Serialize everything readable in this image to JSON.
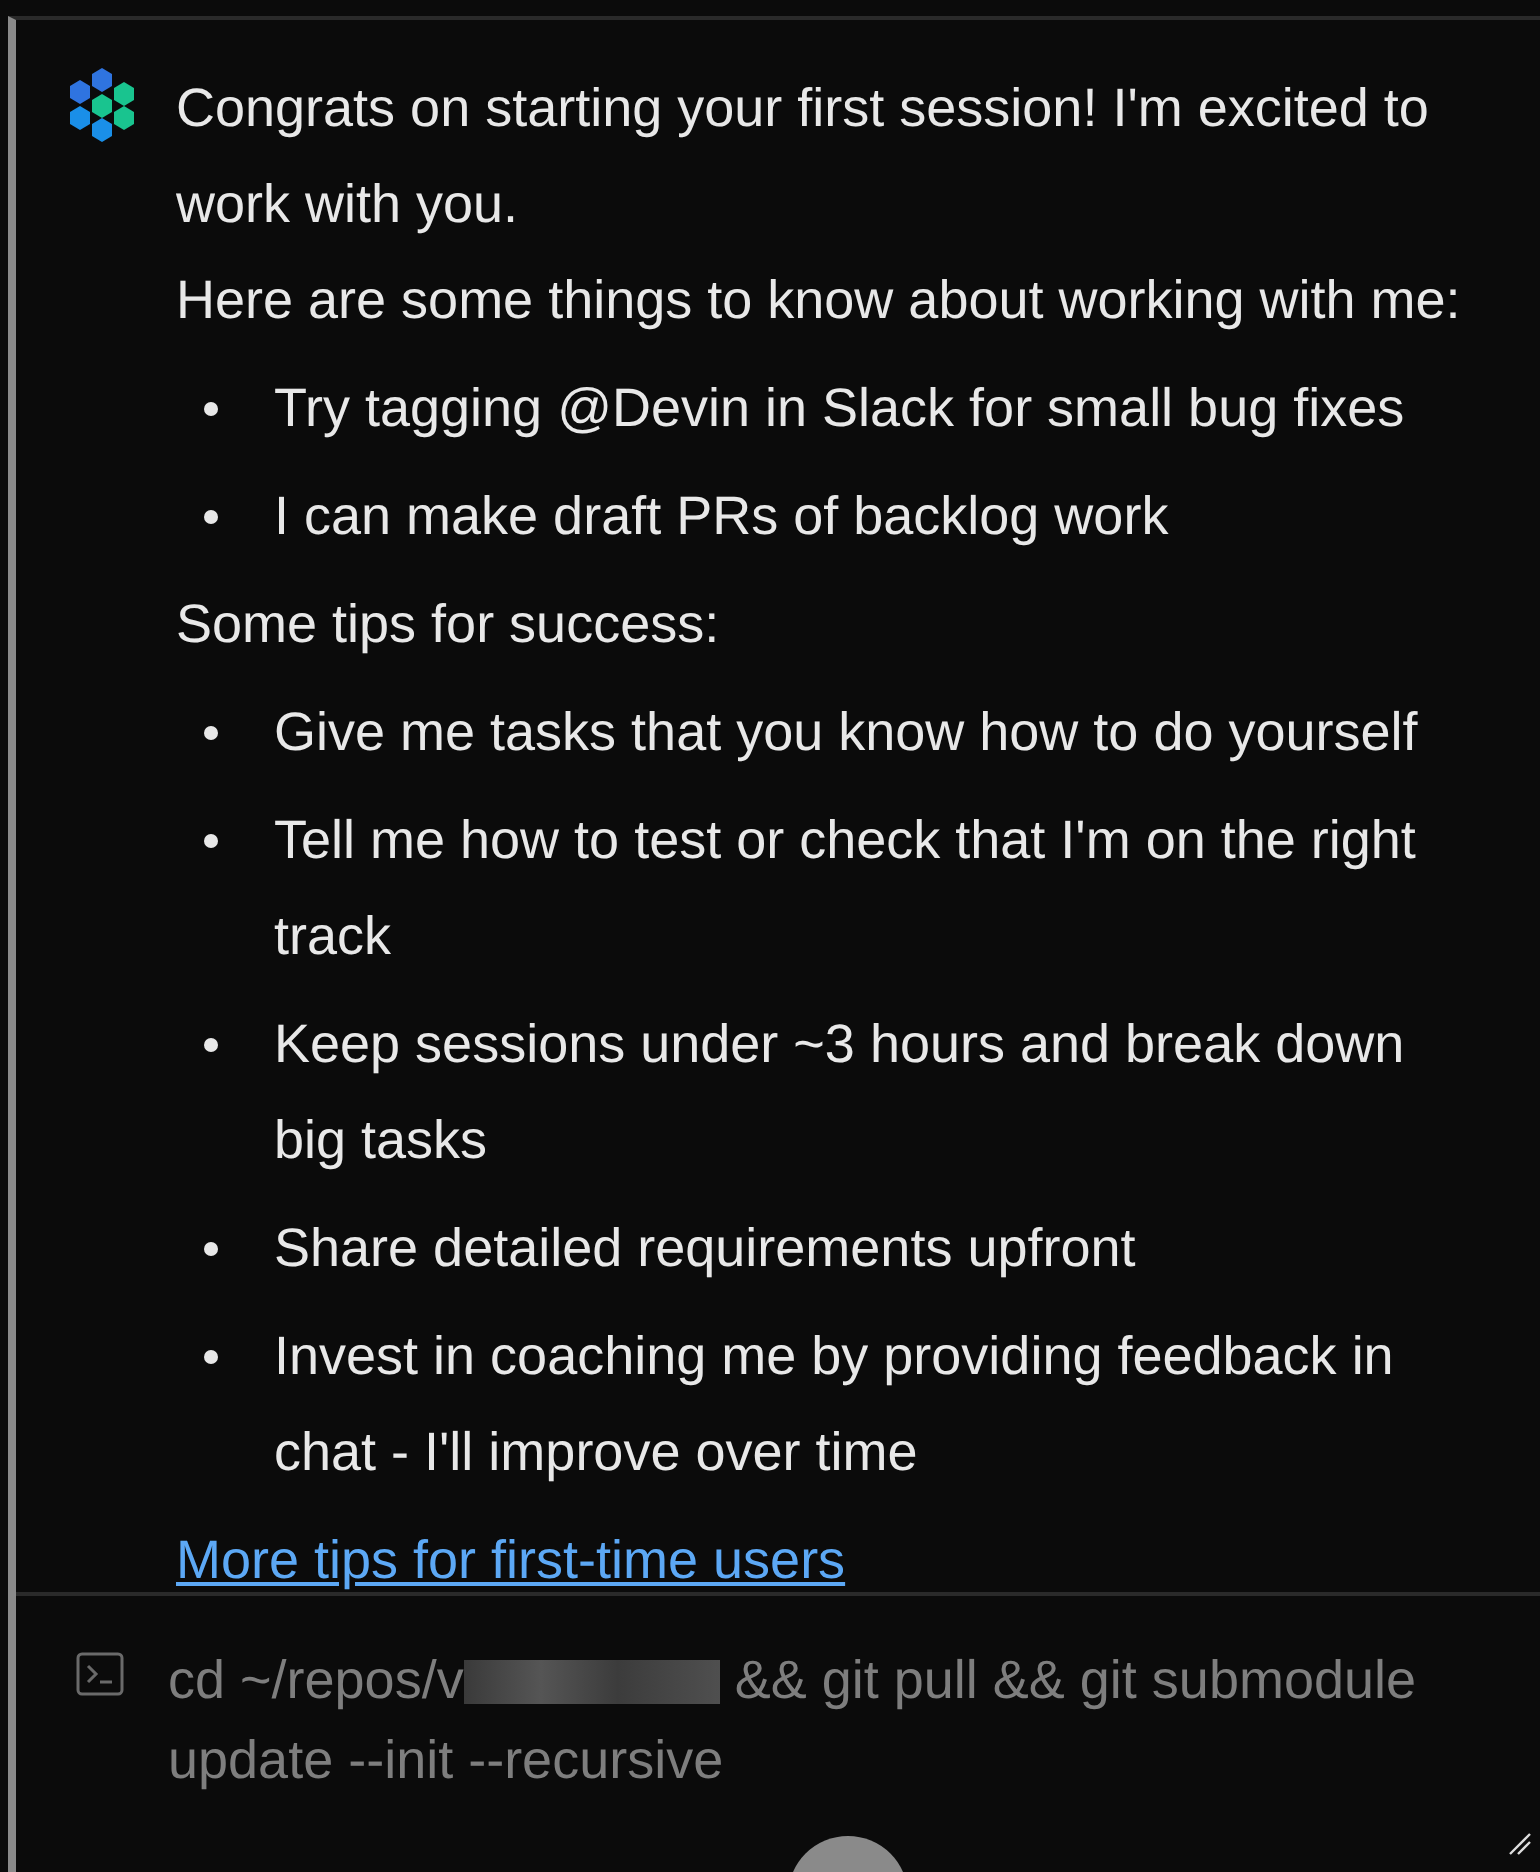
{
  "message": {
    "blocks": [
      {
        "kind": "paragraph",
        "text": "Congrats on starting your first session! I'm excited to work with you."
      },
      {
        "kind": "paragraph",
        "text": "Here are some things to know about working with me:"
      },
      {
        "kind": "list",
        "items": [
          "Try tagging @Devin in Slack for small bug fixes",
          "I can make draft PRs of backlog work"
        ]
      },
      {
        "kind": "paragraph",
        "text": "Some tips for success:"
      },
      {
        "kind": "list",
        "items": [
          "Give me tasks that you know how to do yourself",
          "Tell me how to test or check that I'm on the right track",
          "Keep sessions under ~3 hours and break down big tasks",
          "Share detailed requirements upfront",
          "Invest in coaching me by providing feedback in chat - I'll improve over time"
        ]
      },
      {
        "kind": "link",
        "text": "More tips for first-time users"
      }
    ]
  },
  "command": {
    "before": "cd ~/repos/v",
    "redacted": true,
    "after": "&& git pull && git submodule update --init --recursive"
  }
}
